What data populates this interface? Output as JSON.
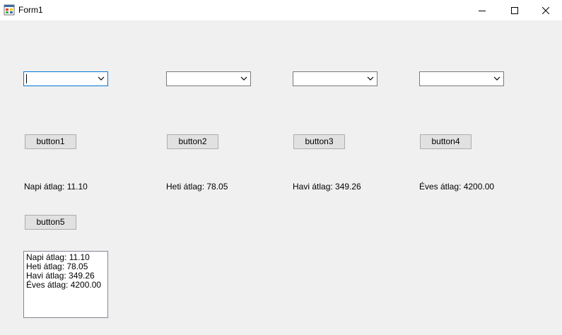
{
  "window": {
    "title": "Form1",
    "icon": "winforms-app-icon",
    "controls": [
      "minimize-icon",
      "maximize-icon",
      "close-icon"
    ]
  },
  "combos": [
    {
      "value": "",
      "focused": true
    },
    {
      "value": "",
      "focused": false
    },
    {
      "value": "",
      "focused": false
    },
    {
      "value": "",
      "focused": false
    }
  ],
  "buttons": [
    "button1",
    "button2",
    "button3",
    "button4",
    "button5"
  ],
  "labels": {
    "napi": "Napi átlag: 11.10",
    "heti": "Heti átlag: 78.05",
    "havi": "Havi átlag: 349.26",
    "eves": "Éves átlag: 4200.00"
  },
  "listbox": {
    "items": [
      "Napi átlag: 11.10",
      "Heti átlag: 78.05",
      "Havi átlag: 349.26",
      "Éves átlag: 4200.00"
    ]
  },
  "colors": {
    "form_background": "#f0f0f0",
    "focus_border": "#0078d7",
    "button_face": "#e1e1e1"
  }
}
